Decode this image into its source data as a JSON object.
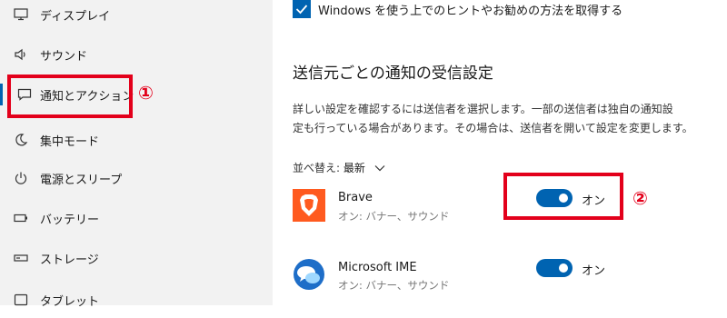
{
  "sidebar": {
    "items": [
      {
        "label": "ディスプレイ",
        "icon": "display-icon"
      },
      {
        "label": "サウンド",
        "icon": "sound-icon"
      },
      {
        "label": "通知とアクション",
        "icon": "notification-icon",
        "selected": true
      },
      {
        "label": "集中モード",
        "icon": "focus-moon-icon"
      },
      {
        "label": "電源とスリープ",
        "icon": "power-icon"
      },
      {
        "label": "バッテリー",
        "icon": "battery-icon"
      },
      {
        "label": "ストレージ",
        "icon": "storage-icon"
      },
      {
        "label": "タブレット",
        "icon": "tablet-icon"
      }
    ]
  },
  "annotations": {
    "callout_1": "①",
    "callout_2": "②",
    "color": "#e3001b"
  },
  "main": {
    "tips_checkbox": {
      "label": "Windows を使う上でのヒントやお勧めの方法を取得する",
      "checked": true
    },
    "section_title": "送信元ごとの通知の受信設定",
    "description_line1": "詳しい設定を確認するには送信者を選択します。一部の送信者は独自の通知設",
    "description_line2": "定も行っている場合があります。その場合は、送信者を開いて設定を変更します。",
    "sort_label": "並べ替え:",
    "sort_value": "最新",
    "apps": [
      {
        "name": "Brave",
        "subtitle": "オン: バナー、サウンド",
        "toggle_label": "オン",
        "on": true
      },
      {
        "name": "Microsoft IME",
        "subtitle": "オン: バナー、サウンド",
        "toggle_label": "オン",
        "on": true
      }
    ]
  },
  "colors": {
    "accent": "#0063b1",
    "sidebar_bg": "#f2f2f2"
  }
}
